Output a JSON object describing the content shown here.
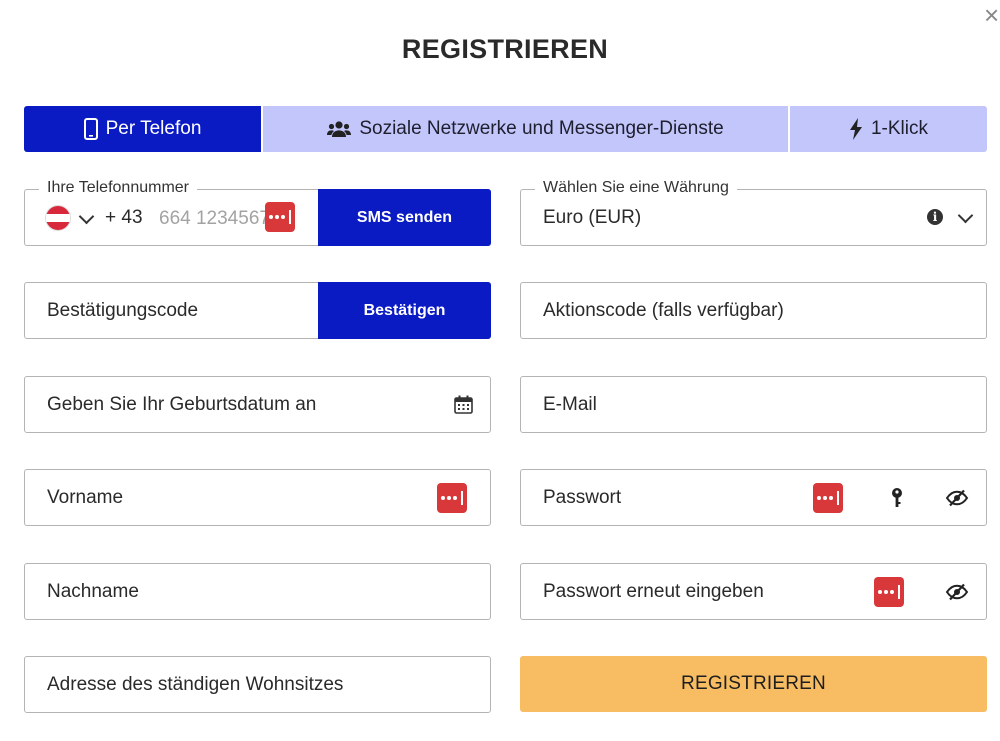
{
  "dialog": {
    "title": "REGISTRIEREN",
    "close_glyph": "×"
  },
  "tabs": [
    {
      "label": "Per Telefon",
      "icon": "smartphone-icon",
      "active": true
    },
    {
      "label": "Soziale Netzwerke und Messenger-Dienste",
      "icon": "users-icon",
      "active": false
    },
    {
      "label": "1-Klick",
      "icon": "lightning-icon",
      "active": false
    }
  ],
  "phone": {
    "legend": "Ihre Telefonnummer",
    "country_prefix": "+ 43",
    "placeholder": "664 1234567",
    "send_sms_label": "SMS senden"
  },
  "currency": {
    "legend": "Wählen Sie eine Währung",
    "selected": "Euro (EUR)"
  },
  "confirmation": {
    "placeholder": "Bestätigungscode",
    "confirm_label": "Bestätigen"
  },
  "promo": {
    "placeholder": "Aktionscode (falls verfügbar)"
  },
  "birthdate": {
    "placeholder": "Geben Sie Ihr Geburtsdatum an"
  },
  "email": {
    "placeholder": "E-Mail"
  },
  "firstname": {
    "placeholder": "Vorname"
  },
  "password": {
    "placeholder": "Passwort"
  },
  "lastname": {
    "placeholder": "Nachname"
  },
  "password_repeat": {
    "placeholder": "Passwort erneut eingeben"
  },
  "address": {
    "placeholder": "Adresse des ständigen Wohnsitzes"
  },
  "submit": {
    "label": "REGISTRIEREN"
  },
  "colors": {
    "primary_blue": "#0a1bc4",
    "tab_inactive": "#c2c6fa",
    "submit_orange": "#f8bd62",
    "password_manager_red": "#d8383a"
  }
}
